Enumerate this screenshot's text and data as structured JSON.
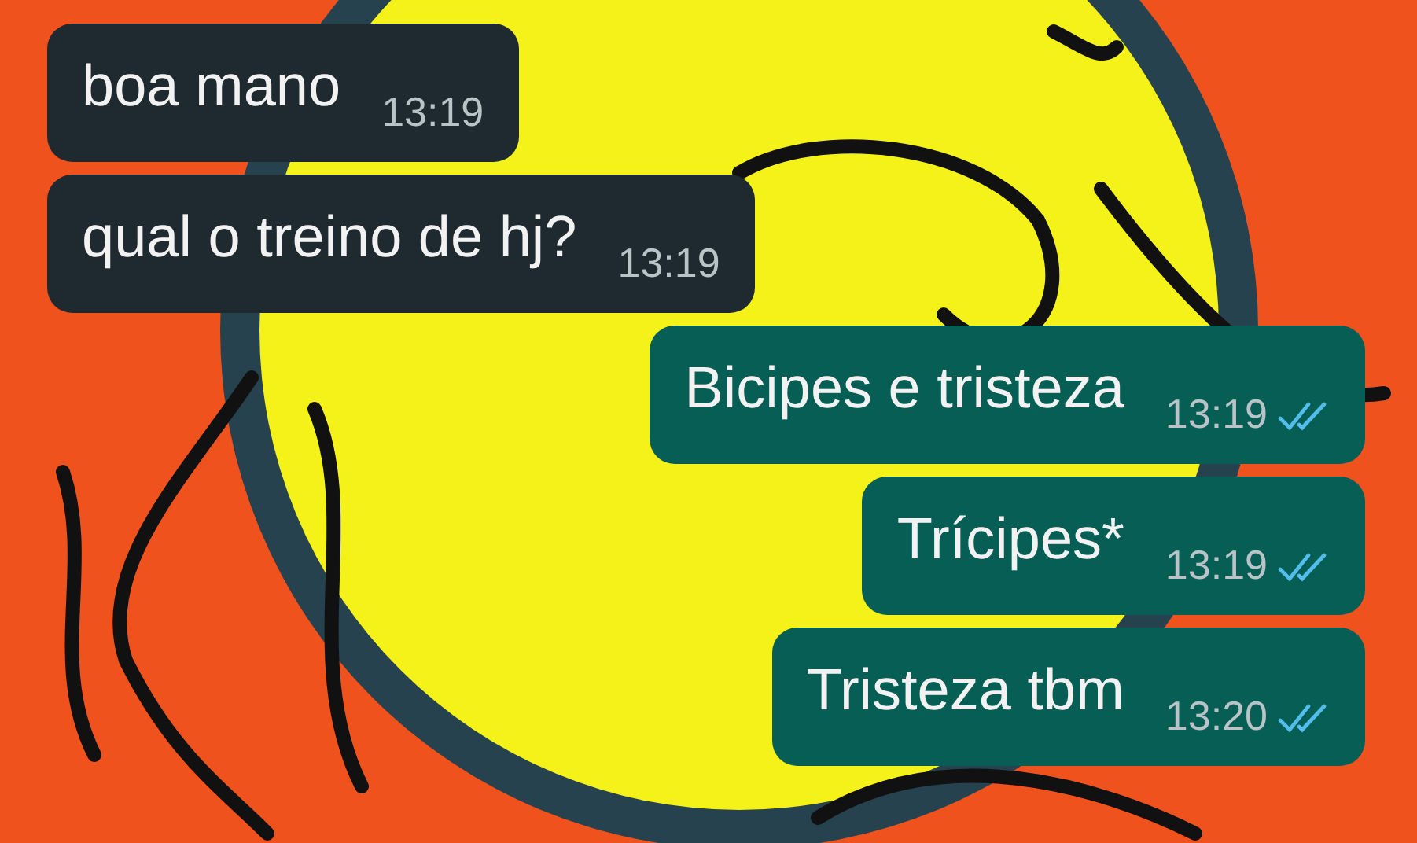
{
  "messages": [
    {
      "kind": "incoming",
      "text": "boa mano",
      "time": "13:19"
    },
    {
      "kind": "incoming",
      "text": "qual o treino de hj?",
      "time": "13:19"
    },
    {
      "kind": "outgoing",
      "text": "Bicipes e tristeza",
      "time": "13:19",
      "read": true
    },
    {
      "kind": "outgoing",
      "text": "Trícipes*",
      "time": "13:19",
      "read": true
    },
    {
      "kind": "outgoing",
      "text": "Tristeza tbm",
      "time": "13:20",
      "read": true
    }
  ]
}
